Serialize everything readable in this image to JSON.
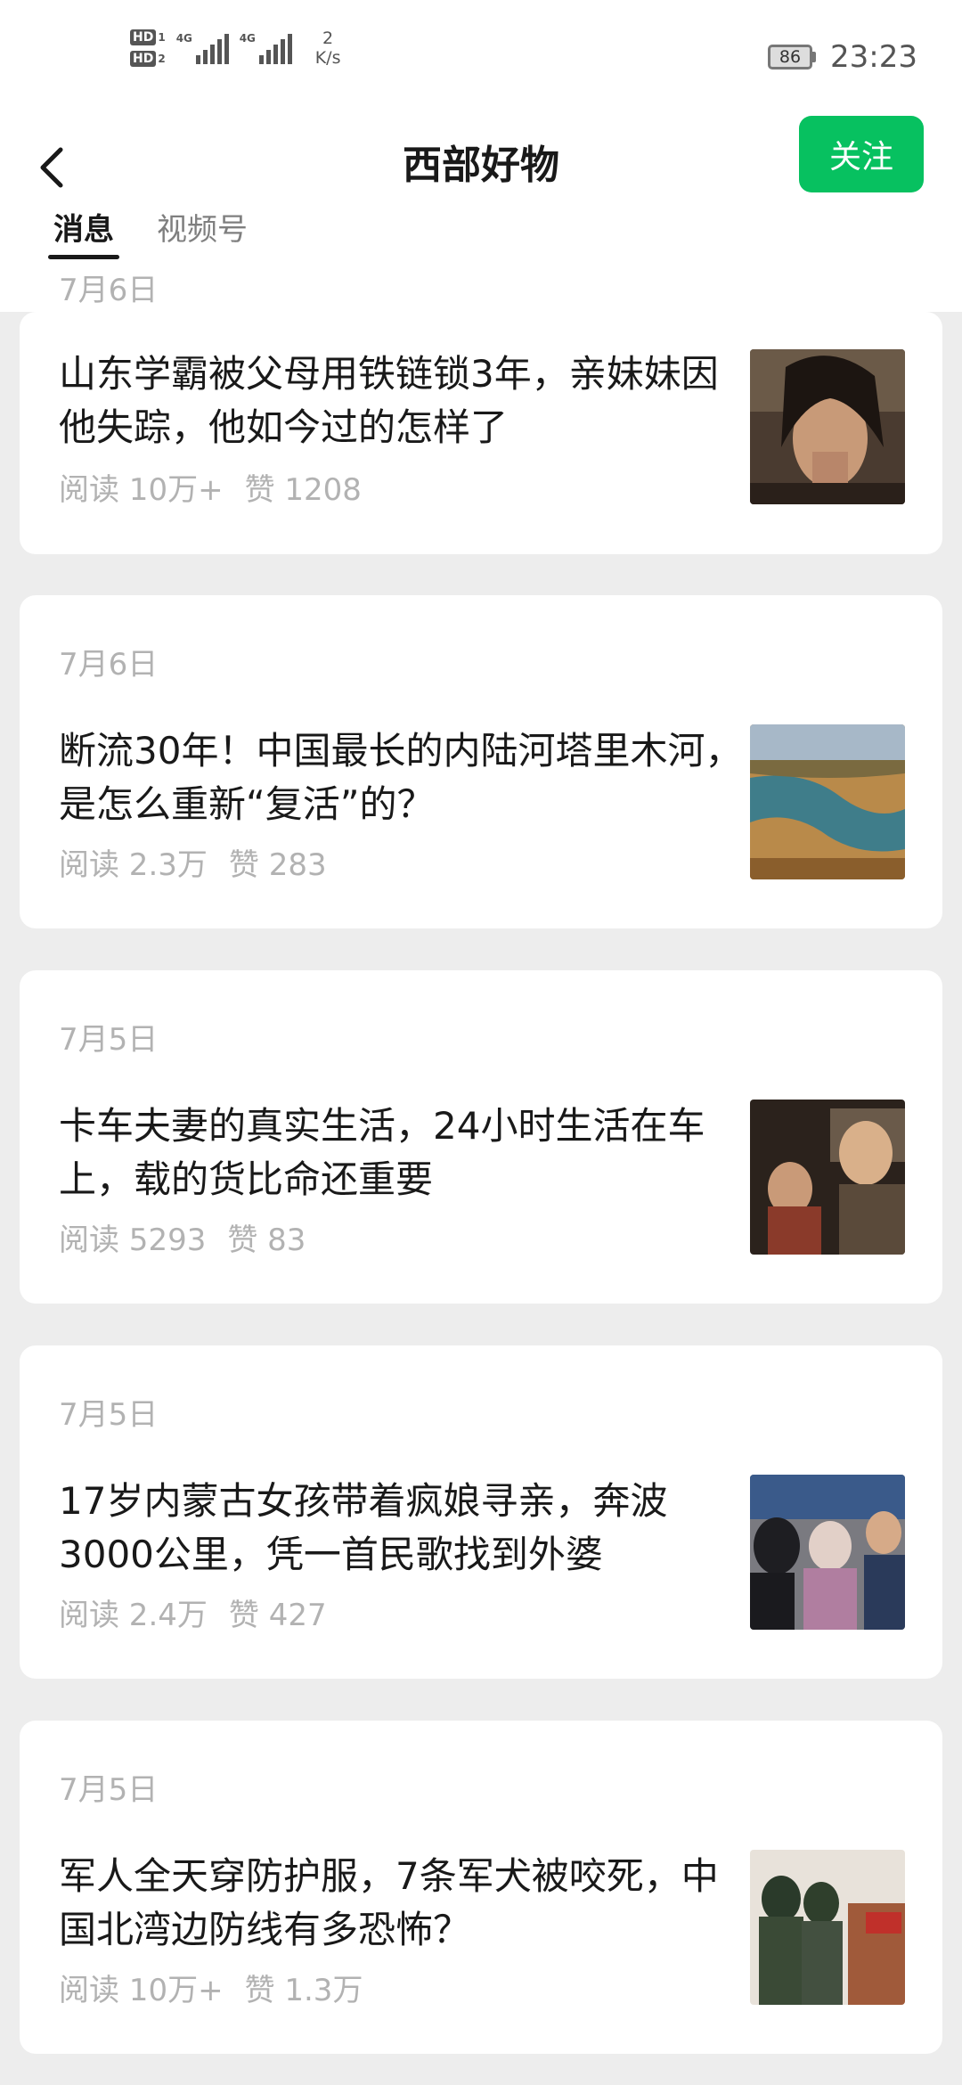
{
  "status_bar": {
    "hd1": "HD",
    "hd1_num": "1",
    "hd2": "HD",
    "hd2_num": "2",
    "sig1_label": "4G",
    "sig2_label": "4G",
    "net_speed_value": "2",
    "net_speed_unit": "K/s",
    "battery": "86",
    "time": "23:23"
  },
  "header": {
    "title": "西部好物",
    "follow_label": "关注",
    "tabs": [
      {
        "label": "消息",
        "active": true
      },
      {
        "label": "视频号",
        "active": false
      }
    ]
  },
  "articles": [
    {
      "date": "7月6日",
      "title": "山东学霸被父母用铁链锁3年，亲妹妹因他失踪，他如今过的怎样了",
      "reads": "阅读 10万+",
      "likes": "赞 1208",
      "thumb_icon": "portrait-photo"
    },
    {
      "date": "7月6日",
      "title": "断流30年！中国最长的内陆河塔里木河，是怎么重新“复活”的？",
      "reads": "阅读 2.3万",
      "likes": "赞 283",
      "thumb_icon": "river-landscape-photo"
    },
    {
      "date": "7月5日",
      "title": "卡车夫妻的真实生活，24小时生活在车上，载的货比命还重要",
      "reads": "阅读 5293",
      "likes": "赞 83",
      "thumb_icon": "truck-cabin-photo"
    },
    {
      "date": "7月5日",
      "title": "17岁内蒙古女孩带着疯娘寻亲，奔波3000公里，凭一首民歌找到外婆",
      "reads": "阅读 2.4万",
      "likes": "赞 427",
      "thumb_icon": "family-reunion-photo"
    },
    {
      "date": "7月5日",
      "title": "军人全天穿防护服，7条军犬被咬死，中国北湾边防线有多恐怖？",
      "reads": "阅读 10万+",
      "likes": "赞 1.3万",
      "thumb_icon": "soldiers-protective-suit-photo"
    }
  ],
  "colors": {
    "accent": "#07c160",
    "background": "#ededed",
    "secondary_text": "#b2b2b2"
  }
}
